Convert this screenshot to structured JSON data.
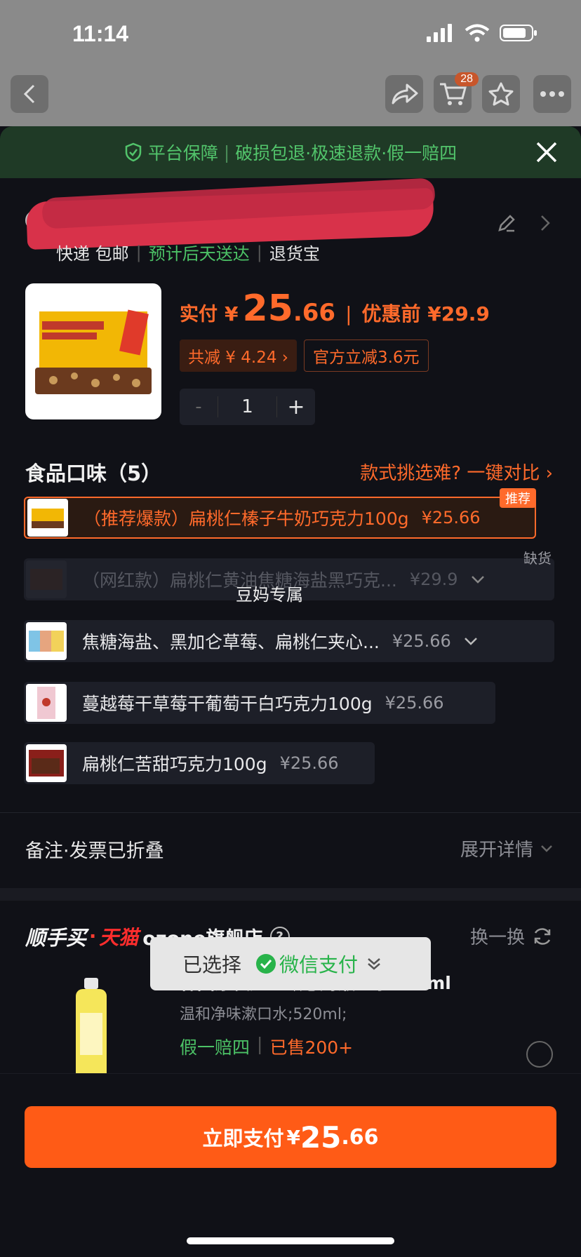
{
  "status_bar": {
    "time": "11:14"
  },
  "top_nav": {
    "cart_count": "28"
  },
  "guarantee": {
    "title": "平台保障",
    "features": "破损包退·极速退款·假一赔四"
  },
  "address": {
    "delivery_label": "快递 包邮",
    "eta": "预计后天送达",
    "return_label": "退货宝"
  },
  "product": {
    "price_label": "实付",
    "currency": "¥",
    "price_int": "25",
    "price_dec": ".66",
    "before_price": "优惠前 ¥29.9",
    "discount_tag": "共减 ¥ 4.24 ›",
    "official_tag": "官方立减3.6元",
    "quantity": "1",
    "minus": "-",
    "plus": "+"
  },
  "flavors": {
    "title": "食品口味（5）",
    "compare_link": "款式挑选难? 一键对比 ›",
    "options": [
      {
        "text": "（推荐爆款）扁桃仁榛子牛奶巧克力100g",
        "price": "¥25.66",
        "badge": "推荐"
      },
      {
        "text": "（网红款）扁桃仁黄油焦糖海盐黑巧克...",
        "price": "¥29.9",
        "badge": "缺货"
      },
      {
        "text": "焦糖海盐、黑加仑草莓、扁桃仁夹心...",
        "price": "¥25.66"
      },
      {
        "text": "蔓越莓干草莓干葡萄干白巧克力100g",
        "price": "¥25.66"
      },
      {
        "text": "扁桃仁苦甜巧克力100g",
        "price": "¥25.66"
      }
    ],
    "watermark": "豆妈专属"
  },
  "notes": {
    "title": "备注·发票已折叠",
    "expand": "展开详情"
  },
  "recommend": {
    "brand_1": "顺手买",
    "brand_2": "天猫",
    "store": "ozone旗舰店",
    "swap": "换一换",
    "name": "韩国原装进口欧志姆漱口水520ml",
    "desc": "温和净味漱口水;520ml;",
    "tag_1": "假一赔四",
    "tag_2": "已售200+"
  },
  "payment": {
    "selected_label": "已选择",
    "method": "微信支付",
    "button_label": "立即支付",
    "currency": "¥",
    "amount_int": "25",
    "amount_dec": ".66"
  },
  "colors": {
    "accent": "#ff6a2b",
    "green": "#4cc266",
    "background": "#101117"
  }
}
